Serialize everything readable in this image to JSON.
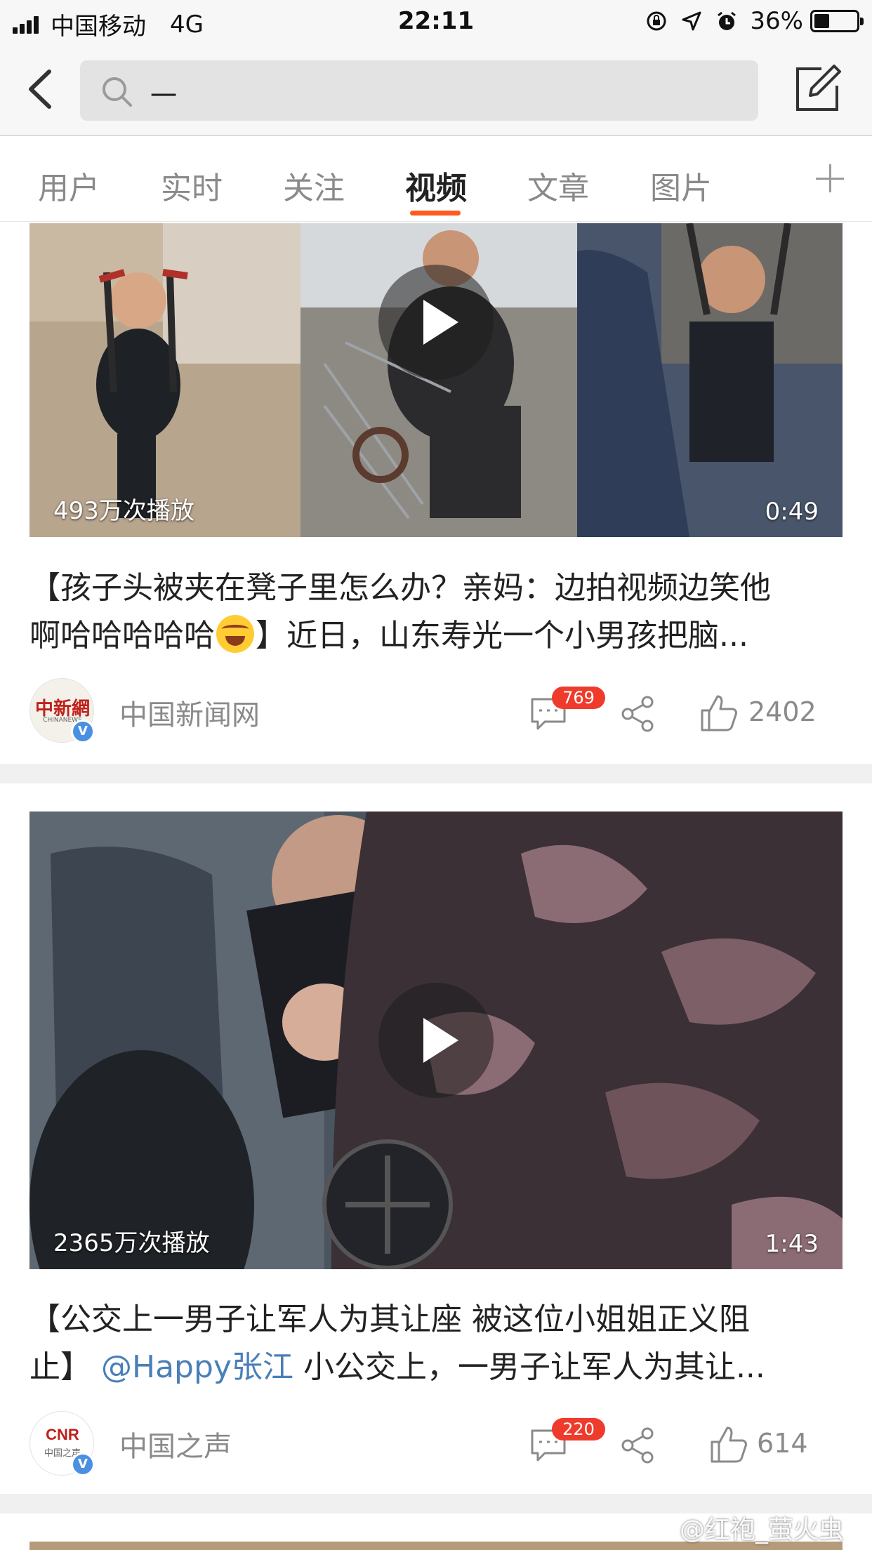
{
  "status_bar": {
    "carrier": "中国移动",
    "network": "4G",
    "time": "22:11",
    "battery": "36%",
    "battery_level": 0.36
  },
  "search": {
    "query": "一"
  },
  "tabs": [
    {
      "label": "用户",
      "active": false
    },
    {
      "label": "实时",
      "active": false
    },
    {
      "label": "关注",
      "active": false
    },
    {
      "label": "视频",
      "active": true
    },
    {
      "label": "文章",
      "active": false
    },
    {
      "label": "图片",
      "active": false
    }
  ],
  "posts": [
    {
      "play_count": "493万次播放",
      "duration": "0:49",
      "headline_line1": "【孩子头被夹在凳子里怎么办？亲妈：边拍视频边笑他",
      "headline_line2_pre": "啊哈哈哈哈哈",
      "headline_line2_post": "】近日，山东寿光一个小男孩把脑...",
      "source": "中国新闻网",
      "avatar_logo": "中新網",
      "avatar_logo_sub": "CHINANEWS",
      "comments": "769",
      "likes": "2402"
    },
    {
      "play_count": "2365万次播放",
      "duration": "1:43",
      "headline_line1": "【公交上一男子让军人为其让座 被这位小姐姐正义阻",
      "headline_line2_pre": "止】",
      "headline_mention": "@Happy张江",
      "headline_line2_post": " 小公交上，一男子让军人为其让...",
      "source": "中国之声",
      "avatar_logo": "CNR",
      "avatar_logo_sub": "中国之声",
      "comments": "220",
      "likes": "614"
    }
  ],
  "watermark": "@红袍_萤火虫",
  "colors": {
    "accent": "#ff5a1f",
    "badge": "#ef3b2c",
    "mention": "#4a7fb8",
    "verify": "#4a90e2"
  }
}
